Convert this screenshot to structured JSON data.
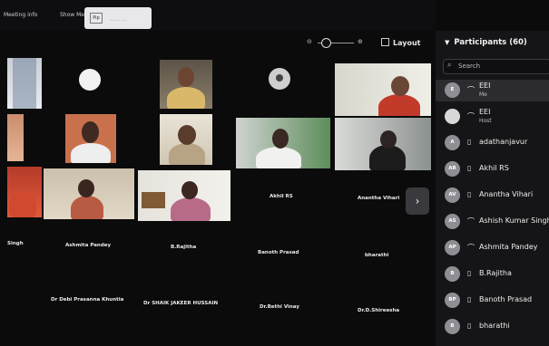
{
  "topbar": {
    "meeting_info": "Meeting info",
    "show_menu": "Show Me",
    "popup_icon": "Pip",
    "popup_dashes": "------"
  },
  "view": {
    "zoom_minus": "⊖",
    "zoom_plus": "⊕",
    "layout_label": "Layout",
    "next_icon": "chevron-right-icon",
    "next_glyph": "›"
  },
  "gallery": {
    "name_labels": [
      "Akhil RS",
      "Anantha Vihari",
      "Singh",
      "Ashmita Pandey",
      "B.Rajitha",
      "Banoth Prasad",
      "bharathi",
      "Dr Debi Prasanna Khuntia",
      "Dr SHAIK JAKEER HUSSAIN",
      "Dr.Bethi Vinay",
      "Dr.D.Shireesha"
    ]
  },
  "participants_panel": {
    "title": "Participants (60)",
    "search_placeholder": "Search",
    "search_icon": "magnifier-icon",
    "items": [
      {
        "initials": "E",
        "device": "headset",
        "name": "EEI",
        "role": "Me",
        "avatar_color": "#8e8e94"
      },
      {
        "initials": "",
        "device": "headset",
        "name": "EEI",
        "role": "Host",
        "avatar_color": "#d8d8d8"
      },
      {
        "initials": "A",
        "device": "phone",
        "name": "adathanjavur",
        "role": "",
        "avatar_color": "#8e8e94"
      },
      {
        "initials": "AR",
        "device": "phone",
        "name": "Akhil RS",
        "role": "",
        "avatar_color": "#8e8e94"
      },
      {
        "initials": "AV",
        "device": "phone",
        "name": "Anantha Vihari",
        "role": "",
        "avatar_color": "#8e8e94"
      },
      {
        "initials": "AS",
        "device": "headset",
        "name": "Ashish Kumar Singh",
        "role": "",
        "avatar_color": "#8e8e94"
      },
      {
        "initials": "AP",
        "device": "headset",
        "name": "Ashmita Pandey",
        "role": "",
        "avatar_color": "#8e8e94"
      },
      {
        "initials": "B",
        "device": "phone",
        "name": "B.Rajitha",
        "role": "",
        "avatar_color": "#8e8e94"
      },
      {
        "initials": "BP",
        "device": "phone",
        "name": "Banoth Prasad",
        "role": "",
        "avatar_color": "#8e8e94"
      },
      {
        "initials": "B",
        "device": "phone",
        "name": "bharathi",
        "role": "",
        "avatar_color": "#8e8e94"
      }
    ]
  },
  "colors": {
    "accent": "#4a8fe7",
    "panel": "#151517",
    "tile_name": "#e9e9e9"
  }
}
